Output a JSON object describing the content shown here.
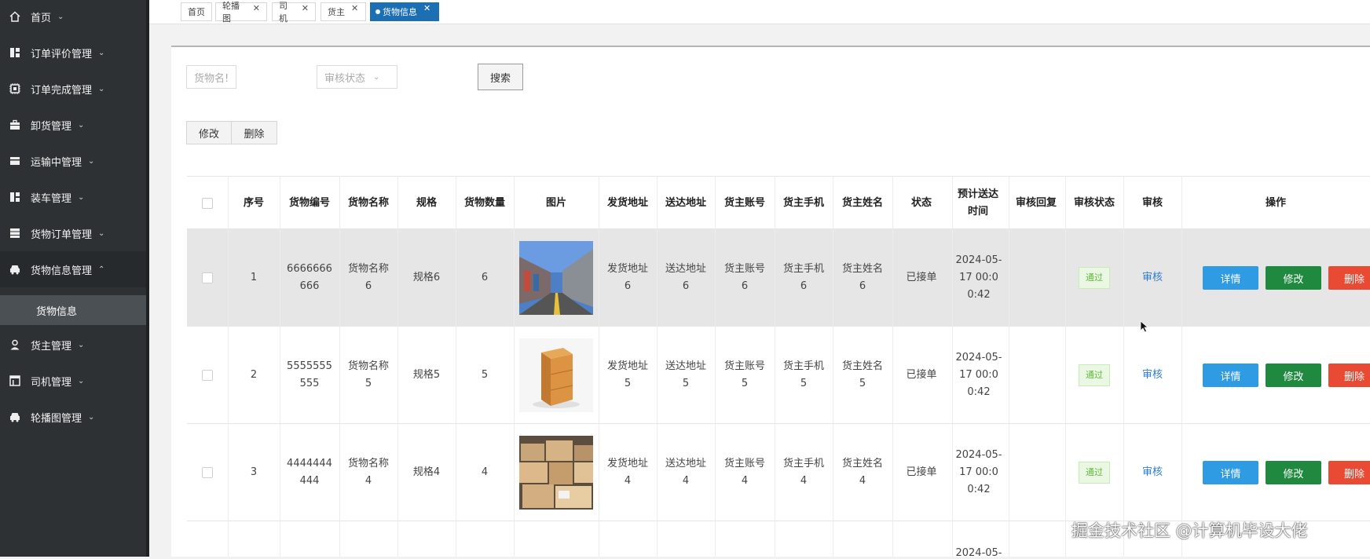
{
  "sidebar": {
    "items": [
      {
        "label": "首页",
        "icon": "home-icon"
      },
      {
        "label": "订单评价管理",
        "icon": "dashboard-icon"
      },
      {
        "label": "订单完成管理",
        "icon": "chip-icon"
      },
      {
        "label": "卸货管理",
        "icon": "briefcase-icon"
      },
      {
        "label": "运输中管理",
        "icon": "wallet-icon"
      },
      {
        "label": "装车管理",
        "icon": "dashboard-icon"
      },
      {
        "label": "货物订单管理",
        "icon": "server-icon"
      },
      {
        "label": "货物信息管理",
        "icon": "car-icon"
      },
      {
        "label": "货主管理",
        "icon": "user-icon"
      },
      {
        "label": "司机管理",
        "icon": "layout-icon"
      },
      {
        "label": "轮播图管理",
        "icon": "car-icon"
      }
    ],
    "submenu_label": "货物信息"
  },
  "tabs": [
    {
      "label": "首页",
      "closable": false
    },
    {
      "label": "轮播图",
      "closable": true
    },
    {
      "label": "司机",
      "closable": true
    },
    {
      "label": "货主",
      "closable": true
    },
    {
      "label": "货物信息",
      "closable": true,
      "active": true
    }
  ],
  "search": {
    "name_placeholder": "货物名!",
    "status_placeholder": "审核状态",
    "search_label": "搜索"
  },
  "toolbar": {
    "edit_label": "修改",
    "delete_label": "删除"
  },
  "table": {
    "headers": {
      "index": "序号",
      "code": "货物编号",
      "name": "货物名称",
      "spec": "规格",
      "qty": "货物数量",
      "image": "图片",
      "from": "发货地址",
      "to": "送达地址",
      "account": "货主账号",
      "phone": "货主手机",
      "owner": "货主姓名",
      "status": "状态",
      "eta": "预计送达时间",
      "reply": "审核回复",
      "audit_status": "审核状态",
      "audit": "审核",
      "actions": "操作"
    },
    "rows": [
      {
        "index": "1",
        "code": "6666666666",
        "name": "货物名称6",
        "spec": "规格6",
        "qty": "6",
        "image": "warehouse-photo",
        "from": "发货地址6",
        "to": "送达地址6",
        "account": "货主账号6",
        "phone": "货主手机6",
        "owner": "货主姓名6",
        "status": "已接单",
        "eta": "2024-05-17 00:00:42",
        "reply": "",
        "audit_status": "通过",
        "audit": "审核"
      },
      {
        "index": "2",
        "code": "5555555555",
        "name": "货物名称5",
        "spec": "规格5",
        "qty": "5",
        "image": "box-photo",
        "from": "发货地址5",
        "to": "送达地址5",
        "account": "货主账号5",
        "phone": "货主手机5",
        "owner": "货主姓名5",
        "status": "已接单",
        "eta": "2024-05-17 00:00:42",
        "reply": "",
        "audit_status": "通过",
        "audit": "审核"
      },
      {
        "index": "3",
        "code": "4444444444",
        "name": "货物名称4",
        "spec": "规格4",
        "qty": "4",
        "image": "boxes-photo",
        "from": "发货地址4",
        "to": "送达地址4",
        "account": "货主账号4",
        "phone": "货主手机4",
        "owner": "货主姓名4",
        "status": "已接单",
        "eta": "2024-05-17 00:00:42",
        "reply": "",
        "audit_status": "通过",
        "audit": "审核"
      }
    ],
    "partial_row": {
      "eta": "2024-05-"
    },
    "action_labels": {
      "detail": "详情",
      "edit": "修改",
      "delete": "删除"
    }
  },
  "watermark": "掘金技术社区 @计算机毕设大佬",
  "colors": {
    "sidebar": "#2d3133",
    "tab_active": "#1c6fb3",
    "btn_detail": "#2f9be3",
    "btn_edit": "#1f8a3f",
    "btn_delete": "#e84a34",
    "badge_text": "#62b83c",
    "link": "#2f7ec9"
  }
}
